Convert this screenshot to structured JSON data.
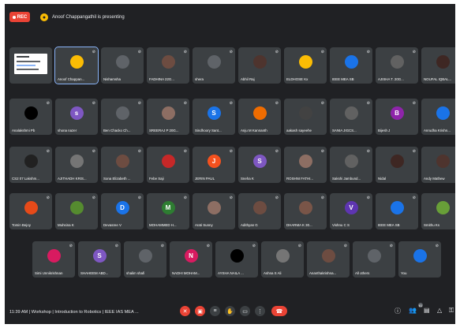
{
  "top_bar": {
    "rec_label": "REC",
    "presenting_text": "Anoof Chappangathil is presenting",
    "presenting_icon": "person-icon"
  },
  "colors": {
    "background": "#202124",
    "tile": "#3c4043",
    "rec": "#ea4335",
    "accent": "#8ab4f8"
  },
  "participants": [
    {
      "name": "",
      "kind": "screen-share"
    },
    {
      "name": "Anoof Chappan...",
      "avatar": "",
      "color": "#fbbc04",
      "active": true
    },
    {
      "name": "Nishamsha",
      "avatar": "",
      "color": "#5f6368"
    },
    {
      "name": "FADHINA 22G...",
      "avatar": "",
      "color": "#6d4c41"
    },
    {
      "name": "shera",
      "avatar": "",
      "color": "#5f6368"
    },
    {
      "name": "Abhil Raj",
      "avatar": "",
      "color": "#4e342e"
    },
    {
      "name": "ELDHOSE Kx",
      "avatar": "",
      "color": "#fbbc04"
    },
    {
      "name": "IEEE MEA SB",
      "avatar": "",
      "color": "#1a73e8"
    },
    {
      "name": "AJISHA T. 20G...",
      "avatar": "",
      "color": "#616161"
    },
    {
      "name": "NOUFAL IQBAL...",
      "avatar": "",
      "color": "#3e2723"
    },
    {
      "name": "Analakshmi Pb",
      "avatar": "",
      "color": "#000000"
    },
    {
      "name": "shona nazer",
      "avatar": "s",
      "color": "#7e57c2"
    },
    {
      "name": "Ben Chacko Ch...",
      "avatar": "",
      "color": "#5f6368"
    },
    {
      "name": "SREERAJ P 20G...",
      "avatar": "",
      "color": "#8d6e63"
    },
    {
      "name": "Sindhoory Sant...",
      "avatar": "S",
      "color": "#1a73e8"
    },
    {
      "name": "Anju M Kannanth",
      "avatar": "",
      "color": "#ef6c00"
    },
    {
      "name": "aakash sayeehe",
      "avatar": "",
      "color": "#424242"
    },
    {
      "name": "SANIA JIGCS...",
      "avatar": "",
      "color": "#616161"
    },
    {
      "name": "Bijesh J",
      "avatar": "B",
      "color": "#8e24aa"
    },
    {
      "name": "Anrudha Krishn...",
      "avatar": "",
      "color": "#1a73e8"
    },
    {
      "name": "CS2 07 Lakshm...",
      "avatar": "",
      "color": "#212121"
    },
    {
      "name": "AJITHADH KRIS...",
      "avatar": "",
      "color": "#757575"
    },
    {
      "name": "Sona Elizabeth ...",
      "avatar": "",
      "color": "#6d4c41"
    },
    {
      "name": "Febe Saji",
      "avatar": "",
      "color": "#c62828"
    },
    {
      "name": "JERIN PAUL",
      "avatar": "J",
      "color": "#f4511e"
    },
    {
      "name": "Sneha K",
      "avatar": "S",
      "color": "#7e57c2"
    },
    {
      "name": "ROSHNI FATHI...",
      "avatar": "",
      "color": "#8d6e63"
    },
    {
      "name": "Sakshi Jambund...",
      "avatar": "",
      "color": "#616161"
    },
    {
      "name": "Nidal",
      "avatar": "",
      "color": "#3e2723"
    },
    {
      "name": "Andy Mathew",
      "avatar": "",
      "color": "#4e342e"
    },
    {
      "name": "Tomin Bejoy",
      "avatar": "",
      "color": "#e64a19"
    },
    {
      "name": "Muhsina K",
      "avatar": "",
      "color": "#558b2f"
    },
    {
      "name": "Devasree V",
      "avatar": "D",
      "color": "#1a73e8"
    },
    {
      "name": "MOHAMMED H...",
      "avatar": "M",
      "color": "#2e7d32"
    },
    {
      "name": "Arati Sunny",
      "avatar": "",
      "color": "#8d6e63"
    },
    {
      "name": "Adithyan G",
      "avatar": "",
      "color": "#6d4c41"
    },
    {
      "name": "DHARMA K 30...",
      "avatar": "",
      "color": "#795548"
    },
    {
      "name": "Vishnu C S",
      "avatar": "V",
      "color": "#5e35b1"
    },
    {
      "name": "IEEE MEA SB",
      "avatar": "",
      "color": "#1a73e8"
    },
    {
      "name": "Smithu Ks",
      "avatar": "",
      "color": "#689f38"
    },
    {
      "name": "Simi Unnikrishnan",
      "avatar": "",
      "color": "#d81b60"
    },
    {
      "name": "SHAHEEM ABD...",
      "avatar": "S",
      "color": "#7e57c2"
    },
    {
      "name": "shalim shafi",
      "avatar": "",
      "color": "#5f6368"
    },
    {
      "name": "NADHI MOHAM...",
      "avatar": "N",
      "color": "#d81b60"
    },
    {
      "name": "AYSHA NAILA ...",
      "avatar": "",
      "color": "#000000"
    },
    {
      "name": "Ashna S Ali",
      "avatar": "",
      "color": "#757575"
    },
    {
      "name": "Ananthakrishna...",
      "avatar": "",
      "color": "#6d4c41"
    },
    {
      "name": "All others",
      "avatar": "",
      "color": "#5f6368"
    },
    {
      "name": "You",
      "avatar": "",
      "color": "#1a73e8"
    }
  ],
  "bottom_bar": {
    "meeting_info": "11:39 AM | Workshop | Introduction to Robotics | IEEE IAS MEA ...",
    "people_count": "61",
    "controls": [
      "mic-off-icon",
      "camera-off-icon",
      "captions-icon",
      "raise-hand-icon",
      "present-icon",
      "more-icon",
      "end-call-icon"
    ],
    "right_icons": [
      "info-icon",
      "people-icon",
      "chat-icon",
      "activities-icon",
      "lock-icon"
    ]
  }
}
